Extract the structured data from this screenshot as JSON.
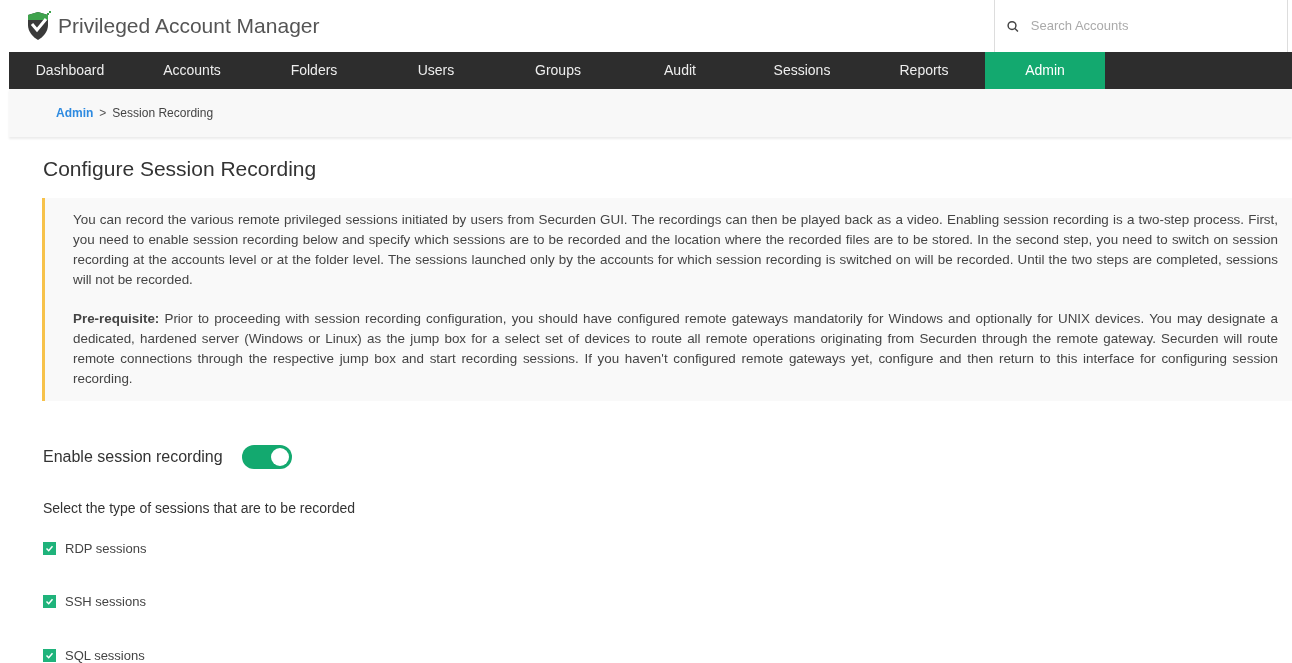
{
  "app": {
    "title": "Privileged Account Manager"
  },
  "search": {
    "placeholder": "Search Accounts"
  },
  "nav": [
    {
      "label": "Dashboard",
      "selected": false
    },
    {
      "label": "Accounts",
      "selected": false
    },
    {
      "label": "Folders",
      "selected": false
    },
    {
      "label": "Users",
      "selected": false
    },
    {
      "label": "Groups",
      "selected": false
    },
    {
      "label": "Audit",
      "selected": false
    },
    {
      "label": "Sessions",
      "selected": false
    },
    {
      "label": "Reports",
      "selected": false
    },
    {
      "label": "Admin",
      "selected": true
    }
  ],
  "breadcrumb": {
    "link": "Admin",
    "separator": ">",
    "current": "Session Recording"
  },
  "page_title": "Configure Session Recording",
  "notice": [
    "You can record the various remote privileged sessions initiated by users from Securden GUI. The recordings can then be played back as a video. Enabling session recording is a two-step process. First, you need to enable session recording below and specify which sessions are to be recorded and the location where the recorded files are to be stored. In the second step, you need to switch on session recording at the accounts level or at the folder level. The sessions launched only by the accounts for which session recording is switched on will be recorded. Until the two steps are completed, sessions will not be recorded.",
    "**Pre-requisite:** Prior to proceeding with session recording configuration, you should have configured remote gateways mandatorily for Windows and optionally for UNIX devices. You may designate a dedicated, hardened server (Windows or Linux) as the jump box for a select set of devices to route all remote operations originating from Securden through the remote gateway. Securden will route remote connections through the respective jump box and start recording sessions. If you haven't configured remote gateways yet, configure and then return to this interface for configuring session recording."
  ],
  "enable": {
    "label": "Enable session recording",
    "on": true
  },
  "session_types": {
    "heading": "Select the type of sessions that are to be recorded",
    "items": [
      {
        "label": "RDP sessions",
        "checked": true
      },
      {
        "label": "SSH sessions",
        "checked": true
      },
      {
        "label": "SQL sessions",
        "checked": true
      }
    ]
  }
}
